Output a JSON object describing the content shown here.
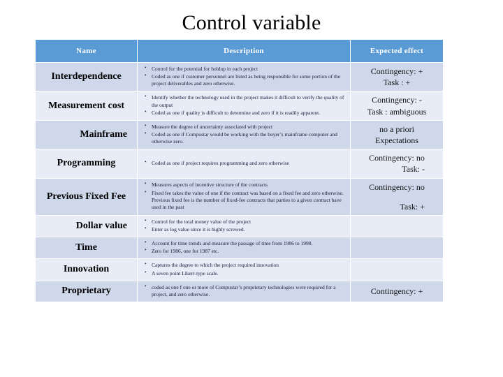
{
  "slide": {
    "title": "Control variable"
  },
  "table": {
    "headers": {
      "name": "Name",
      "description": "Description",
      "expected_effect": "Expected effect"
    },
    "rows": [
      {
        "name": "Interdependence",
        "bullets": [
          "Control for the potential for holdup in each project",
          "Coded as one if customer personnel are listed as being responsible for some portion of the project deliverables and zero otherwise."
        ],
        "effect_lines": [
          "Contingency: +",
          "Task : +"
        ],
        "effect_spacer": false
      },
      {
        "name": "Measurement cost",
        "bullets": [
          "Identify whether the technology used in the project makes it difficult to verify the quality of the output",
          "Coded as one if quality is difficult to determine and zero if it is readily apparent."
        ],
        "effect_lines": [
          "Contingency: -",
          "Task : ambiguous"
        ],
        "effect_spacer": false
      },
      {
        "name": "Mainframe",
        "bullets": [
          "Measure the degree of uncertainty associated with project",
          "Coded as one if Compustar would be working with the buyer’s mainframe computer and otherwise zero."
        ],
        "effect_lines": [
          "no a priori",
          "Expectations"
        ],
        "effect_spacer": false
      },
      {
        "name": "Programming",
        "bullets": [
          "Coded as one if project requires programming and zero otherwise"
        ],
        "effect_lines": [
          "Contingency: no",
          "Task: -"
        ],
        "effect_spacer": false,
        "effect_second_right": true
      },
      {
        "name": "Previous Fixed Fee",
        "bullets": [
          "Measures aspects of incentive structure of the contracts",
          "Fixed fee takes the value of one if the contract was based on a fixed fee and zero otherwise. Previous fixed fee is the number of fixed-fee contracts that parties to a given contract have used in the past"
        ],
        "effect_lines": [
          "Contingency: no",
          "Task: +"
        ],
        "effect_spacer": true,
        "effect_second_right": true
      },
      {
        "name": "Dollar value",
        "bullets": [
          "Control for the total money value of the project",
          "Enter as log value since it is highly screwed."
        ],
        "effect_lines": [],
        "effect_spacer": false
      },
      {
        "name": "Time",
        "bullets": [
          "Account for time trends and measure the passage of time from 1986 to 1998.",
          "Zero for 1986, one for 1987 etc."
        ],
        "effect_lines": [],
        "effect_spacer": false
      },
      {
        "name": "Innovation",
        "bullets": [
          "Captures the degree to which the project required innovation",
          "A seven point Likert-type scale."
        ],
        "effect_lines": [],
        "effect_spacer": false
      },
      {
        "name": "Proprietary",
        "bullets": [
          "coded as one f one or more of Compustar’s proprietary technologies were required for a project, and zero otherwise."
        ],
        "effect_lines": [
          "Contingency: +"
        ],
        "effect_spacer": false
      }
    ]
  },
  "colors": {
    "header_blue": "#5b9bd5",
    "band_a": "#cfd8ea",
    "band_b": "#e8ecf7",
    "text": "#000000"
  }
}
